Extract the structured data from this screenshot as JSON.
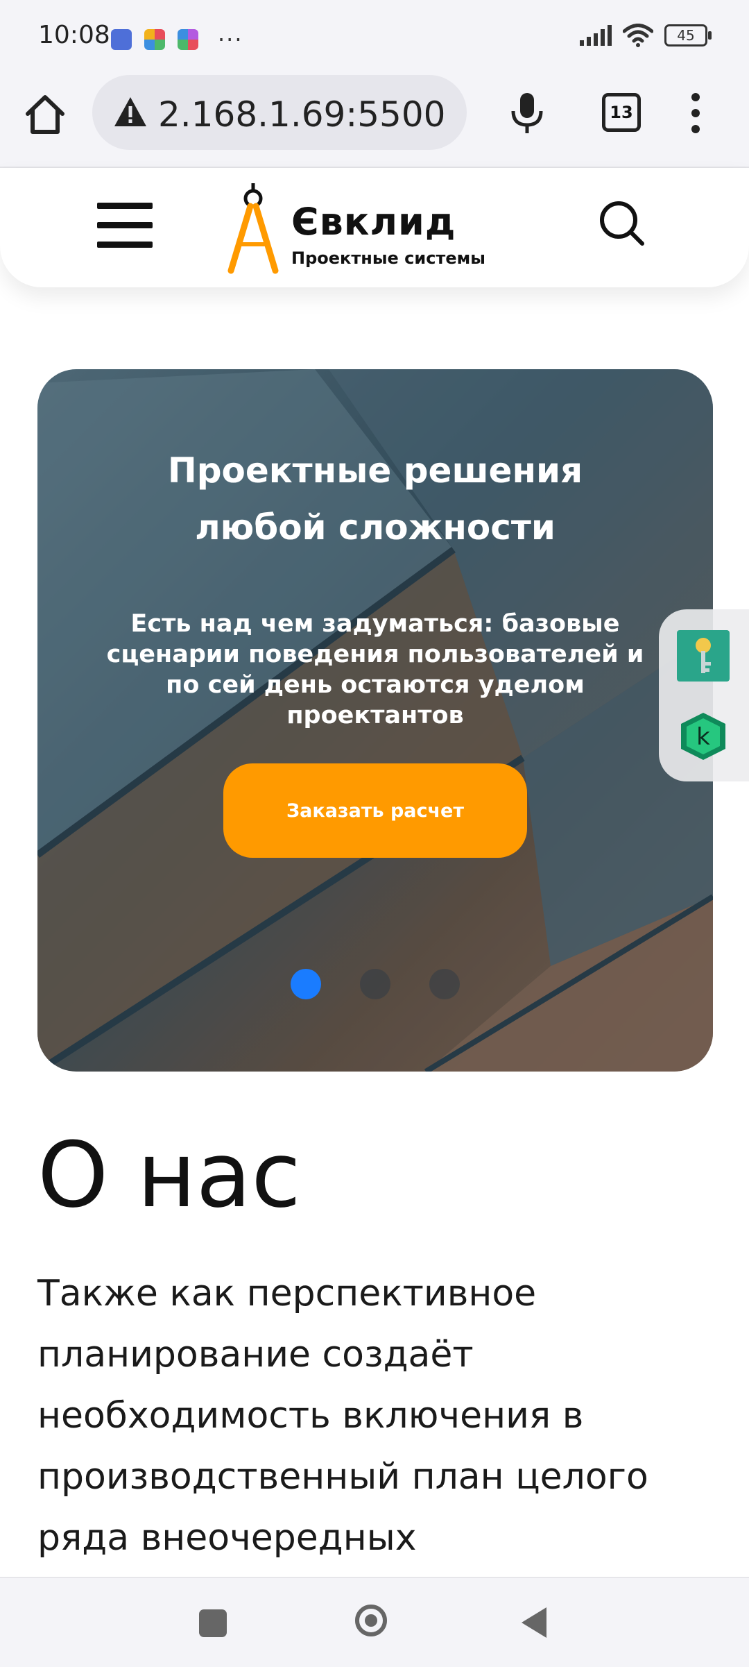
{
  "status_bar": {
    "time": "10:08",
    "more_notifications": "···",
    "battery": "45"
  },
  "browser": {
    "url": "2.168.1.69:5500",
    "tab_count": "13"
  },
  "site_header": {
    "logo_title": "Євклид",
    "logo_subtitle": "Проектные системы"
  },
  "hero": {
    "title_line1": "Проектные решения",
    "title_line2": "любой сложности",
    "text": "Есть над чем задуматься: базовые сценарии поведения пользователей и по сей день остаются уделом проектантов",
    "cta_label": "Заказать расчет",
    "slide_count": 3,
    "active_slide": 1
  },
  "about": {
    "title": "О нас",
    "text": "Также как перспективное планирование создаёт необходимость включения в производственный план целого ряда внеочередных"
  },
  "colors": {
    "accent": "#ff9a00",
    "active_dot": "#1a7cff"
  }
}
